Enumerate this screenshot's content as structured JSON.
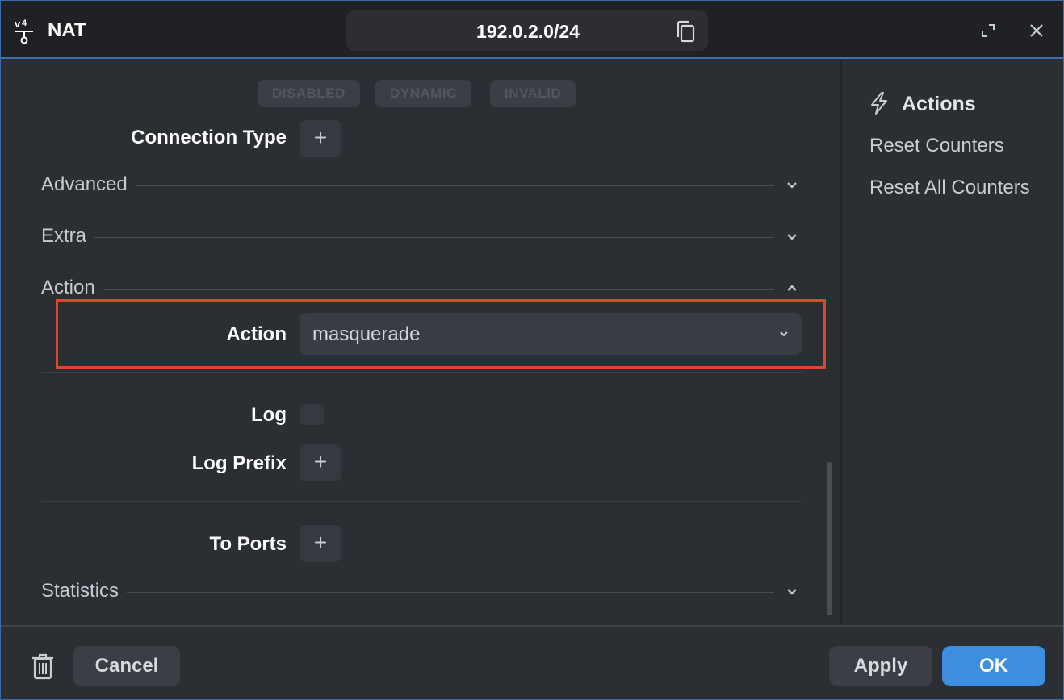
{
  "window": {
    "title": "NAT",
    "icon": "ipv4-nat-icon",
    "address": "192.0.2.0/24"
  },
  "chips": [
    "DISABLED",
    "DYNAMIC",
    "INVALID"
  ],
  "fields": {
    "connection_type": "Connection Type",
    "action_label": "Action",
    "action_value": "masquerade",
    "log": "Log",
    "log_checked": false,
    "log_prefix": "Log Prefix",
    "to_ports": "To Ports"
  },
  "sections": {
    "advanced": "Advanced",
    "extra": "Extra",
    "action": "Action",
    "statistics": "Statistics"
  },
  "side": {
    "title": "Actions",
    "reset_counters": "Reset Counters",
    "reset_all_counters": "Reset All Counters"
  },
  "footer": {
    "cancel": "Cancel",
    "apply": "Apply",
    "ok": "OK"
  },
  "colors": {
    "accent": "#3d8de0",
    "highlight": "#e2462a",
    "titlebar_border": "#3b6fb0"
  }
}
